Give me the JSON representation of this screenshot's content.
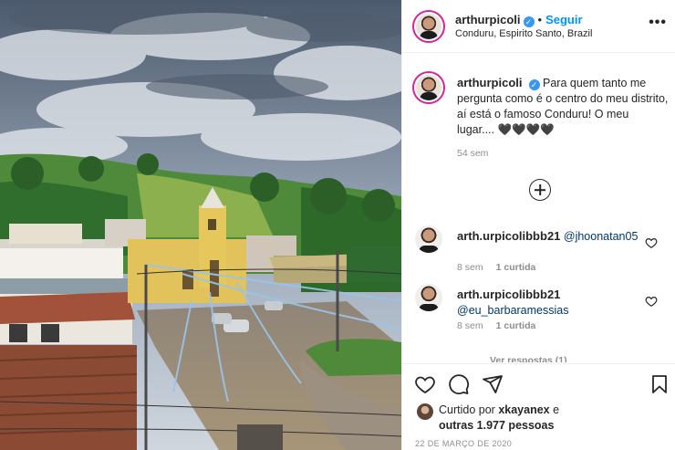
{
  "post": {
    "username": "arthurpicoli",
    "verified": true,
    "follow_label": "Seguir",
    "separator": "•",
    "location": "Conduru, Espirito Santo, Brazil",
    "more_label": "•••",
    "photo_alt": "Photo"
  },
  "caption": {
    "username": "arthurpicoli",
    "text": "Para quem tanto me pergunta como é o centro do meu distrito, aí está o famoso Conduru! O meu lugar.... 🖤🖤🖤🖤",
    "time": "54 sem"
  },
  "comments": [
    {
      "username": "arth.urpicolibbb21",
      "mention": "@jhoonatan05",
      "time": "8 sem",
      "likes": "1 curtida"
    },
    {
      "username": "arth.urpicolibbb21",
      "mention": "@eu_barbaramessias",
      "time": "8 sem",
      "likes": "1 curtida"
    }
  ],
  "view_replies": "Ver respostas (1)",
  "liked_by": {
    "prefix": "Curtido por",
    "user": "xkayanex",
    "middle": "e",
    "others": "outras 1.977 pessoas"
  },
  "date": "22 DE MARÇO DE 2020",
  "icons": [
    "heart-icon",
    "comment-icon",
    "share-icon",
    "bookmark-icon",
    "add-comment-icon",
    "more-icon",
    "verified-badge-icon"
  ],
  "colors": {
    "follow": "#0095f6",
    "meta": "#8e8e8e",
    "mention": "#00376b",
    "verified": "#3897f0"
  }
}
